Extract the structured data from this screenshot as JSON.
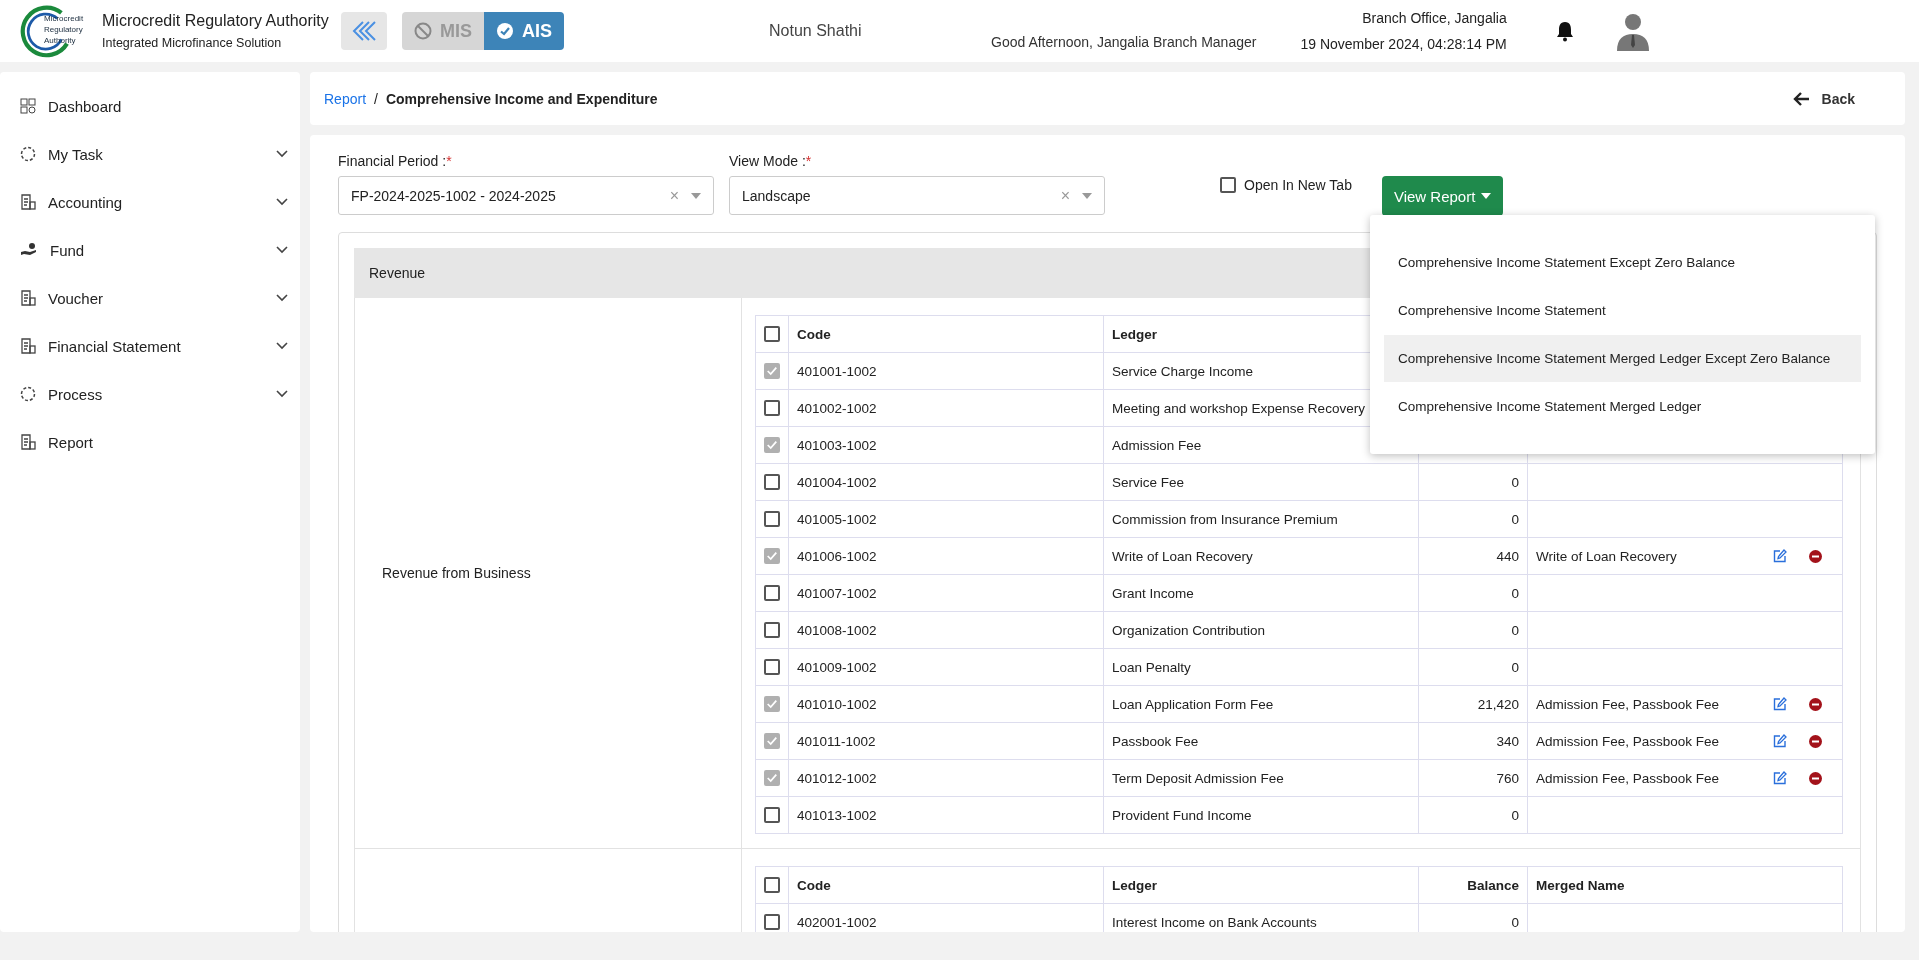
{
  "header": {
    "logo_lines": [
      "Microcredit",
      "Regulatory",
      "Authority"
    ],
    "org_name": "Microcredit Regulatory Authority",
    "org_subtitle": "Integrated Microfinance Solution",
    "modules": [
      {
        "label": "MIS",
        "selected": false
      },
      {
        "label": "AIS",
        "selected": true
      }
    ],
    "app_name": "Notun Shathi",
    "greeting": "Good Afternoon, Jangalia Branch Manager",
    "branch": "Branch Office, Jangalia",
    "datetime": "19 November 2024, 04:28:14 PM"
  },
  "sidebar": {
    "items": [
      {
        "label": "Dashboard",
        "expandable": false
      },
      {
        "label": "My Task",
        "expandable": true
      },
      {
        "label": "Accounting",
        "expandable": true
      },
      {
        "label": "Fund",
        "expandable": true
      },
      {
        "label": "Voucher",
        "expandable": true
      },
      {
        "label": "Financial Statement",
        "expandable": true
      },
      {
        "label": "Process",
        "expandable": true
      },
      {
        "label": "Report",
        "expandable": false
      }
    ]
  },
  "breadcrumb": {
    "link": "Report",
    "separator": "/",
    "current": "Comprehensive Income and Expenditure",
    "back": "Back"
  },
  "filters": {
    "fields": [
      {
        "label": "Financial Period :",
        "required_mark": "*",
        "value": "FP-2024-2025-1002 - 2024-2025",
        "clear": "×"
      },
      {
        "label": "View Mode :",
        "required_mark": "*",
        "value": "Landscape",
        "clear": "×"
      }
    ],
    "open_in_new_tab": {
      "label": "Open In New Tab",
      "checked": false
    },
    "view_report": {
      "label": "View Report",
      "expanded": true
    }
  },
  "report_menu": [
    {
      "label": "Comprehensive Income Statement Except Zero Balance",
      "selected": false
    },
    {
      "label": "Comprehensive Income Statement",
      "selected": false
    },
    {
      "label": "Comprehensive Income Statement Merged Ledger Except Zero Balance",
      "selected": true
    },
    {
      "label": "Comprehensive Income Statement Merged Ledger",
      "selected": false
    }
  ],
  "section": {
    "title": "Revenue",
    "groups": [
      {
        "name": "Revenue from Business",
        "columns": [
          "Code",
          "Ledger"
        ],
        "header_checked": false,
        "rows": [
          {
            "code": "401001-1002",
            "ledger": "Service Charge Income",
            "checked": true
          },
          {
            "code": "401002-1002",
            "ledger": "Meeting and workshop Expense Recovery",
            "checked": false
          },
          {
            "code": "401003-1002",
            "ledger": "Admission Fee",
            "checked": true
          },
          {
            "code": "401004-1002",
            "ledger": "Service Fee",
            "balance": "0",
            "checked": false
          },
          {
            "code": "401005-1002",
            "ledger": "Commission from Insurance Premium",
            "balance": "0",
            "checked": false
          },
          {
            "code": "401006-1002",
            "ledger": "Write of Loan Recovery",
            "balance": "440",
            "merged": "Write of Loan Recovery",
            "checked": true
          },
          {
            "code": "401007-1002",
            "ledger": "Grant Income",
            "balance": "0",
            "checked": false
          },
          {
            "code": "401008-1002",
            "ledger": "Organization Contribution",
            "balance": "0",
            "checked": false
          },
          {
            "code": "401009-1002",
            "ledger": "Loan Penalty",
            "balance": "0",
            "checked": false
          },
          {
            "code": "401010-1002",
            "ledger": "Loan Application Form Fee",
            "balance": "21,420",
            "merged": "Admission Fee, Passbook Fee",
            "checked": true
          },
          {
            "code": "401011-1002",
            "ledger": "Passbook Fee",
            "balance": "340",
            "merged": "Admission Fee, Passbook Fee",
            "checked": true
          },
          {
            "code": "401012-1002",
            "ledger": "Term Deposit Admission Fee",
            "balance": "760",
            "merged": "Admission Fee, Passbook Fee",
            "checked": true
          },
          {
            "code": "401013-1002",
            "ledger": "Provident Fund Income",
            "balance": "0",
            "checked": false
          }
        ]
      },
      {
        "columns": [
          "Code",
          "Ledger",
          "Balance",
          "Merged Name"
        ],
        "header_checked": false,
        "rows": [
          {
            "code": "402001-1002",
            "ledger": "Interest Income on Bank Accounts",
            "balance": "0",
            "checked": false
          }
        ]
      }
    ]
  }
}
